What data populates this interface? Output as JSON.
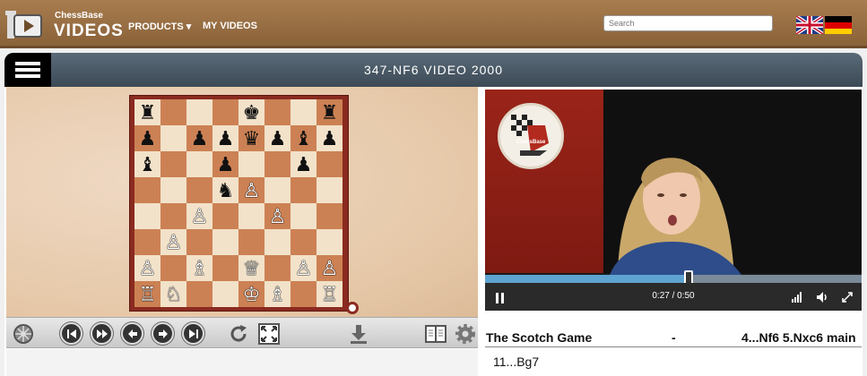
{
  "header": {
    "brand_small": "ChessBase",
    "brand_big": "VIDEOS",
    "nav": [
      {
        "label": "PRODUCTS ▾"
      },
      {
        "label": "MY VIDEOS"
      }
    ],
    "search": {
      "placeholder": "Search",
      "value": ""
    },
    "flags": [
      "uk-flag-icon",
      "germany-flag-icon"
    ]
  },
  "page": {
    "title": "347-NF6 VIDEO 2000"
  },
  "board": {
    "ranks": [
      [
        "♜",
        "",
        "",
        "",
        "♚",
        "",
        "",
        "♜"
      ],
      [
        "♟",
        "",
        "♟",
        "♟",
        "♛",
        "♟",
        "♝",
        "♟"
      ],
      [
        "♝",
        "",
        "",
        "♟",
        "",
        "",
        "♟",
        ""
      ],
      [
        "",
        "",
        "",
        "♞",
        "♙",
        "",
        "",
        ""
      ],
      [
        "",
        "",
        "♙",
        "",
        "",
        "♙",
        "",
        ""
      ],
      [
        "",
        "♙",
        "",
        "",
        "",
        "",
        "",
        ""
      ],
      [
        "♙",
        "",
        "♗",
        "",
        "♕",
        "",
        "♙",
        "♙"
      ],
      [
        "♖",
        "♘",
        "",
        "",
        "♔",
        "♗",
        "",
        "♖"
      ]
    ],
    "white_pieces": "♔♕♖♗♘♙"
  },
  "controls": {
    "buttons": [
      "wheel-icon",
      "first-move-icon",
      "fast-forward-icon",
      "previous-move-icon",
      "next-move-icon",
      "last-move-icon",
      "rotate-icon",
      "fullscreen-icon",
      "download-icon",
      "book-icon",
      "settings-icon"
    ]
  },
  "video": {
    "time": "0:27 / 0:50",
    "progress": 0.54,
    "logo_text": "ChessBase"
  },
  "game": {
    "name": "The Scotch Game",
    "dash": "-",
    "moves": "4...Nf6 5.Nxc6 main",
    "current": "11...Bg7"
  },
  "colors": {
    "header": "#9a6f44",
    "board_frame": "#8a2a20",
    "light_square": "#f2e2c9",
    "dark_square": "#cc8154",
    "progress": "#5fa3d0"
  }
}
